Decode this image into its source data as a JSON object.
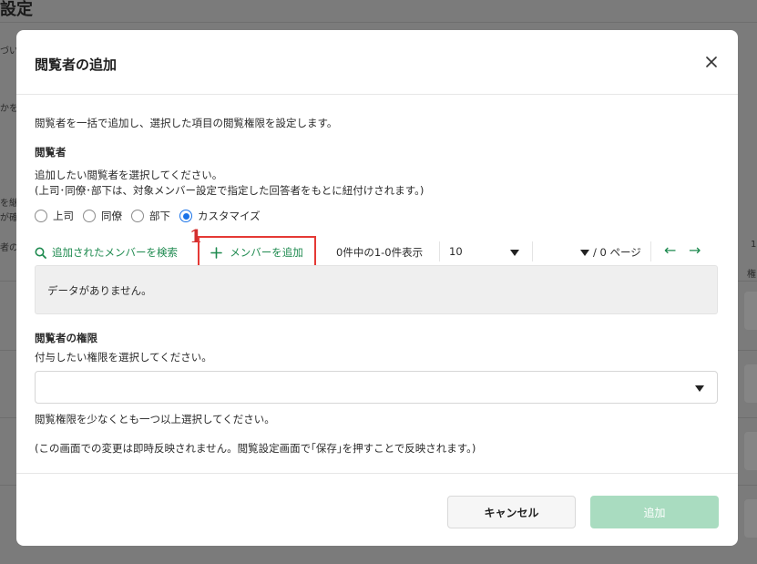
{
  "background": {
    "title": "設定",
    "fragments": [
      "づい",
      "かを",
      "を継",
      "が確",
      "者の",
      "1",
      "権"
    ]
  },
  "modal": {
    "title": "閲覧者の追加",
    "close_icon": "close-icon",
    "description": "閲覧者を一括で追加し、選択した項目の閲覧権限を設定します。",
    "viewers_heading": "閲覧者",
    "viewers_instruction": "追加したい閲覧者を選択してください。",
    "viewers_note": "(上司･同僚･部下は、対象メンバー設定で指定した回答者をもとに紐付けされます。)",
    "radios": [
      {
        "label": "上司",
        "selected": false
      },
      {
        "label": "同僚",
        "selected": false
      },
      {
        "label": "部下",
        "selected": false
      },
      {
        "label": "カスタマイズ",
        "selected": true
      }
    ],
    "search_link": "追加されたメンバーを検索",
    "add_member_button": "メンバーを追加",
    "add_member_annotation": "1",
    "pager_text": "0件中の1-0件表示",
    "per_page_value": "10",
    "page_count": "/ 0 ページ",
    "empty_message": "データがありません。",
    "permission_heading": "閲覧者の権限",
    "permission_instruction": "付与したい権限を選択してください。",
    "permission_error": "閲覧権限を少なくとも一つ以上選択してください。",
    "footer_note": "(この画面での変更は即時反映されません。閲覧設定画面で｢保存｣を押すことで反映されます。)",
    "cancel_button": "キャンセル",
    "add_button": "追加"
  },
  "colors": {
    "accent_green": "#1e8a4f",
    "disabled_green": "#a9dcc0",
    "radio_blue": "#1a73e8",
    "annotation_red": "#e53935"
  }
}
